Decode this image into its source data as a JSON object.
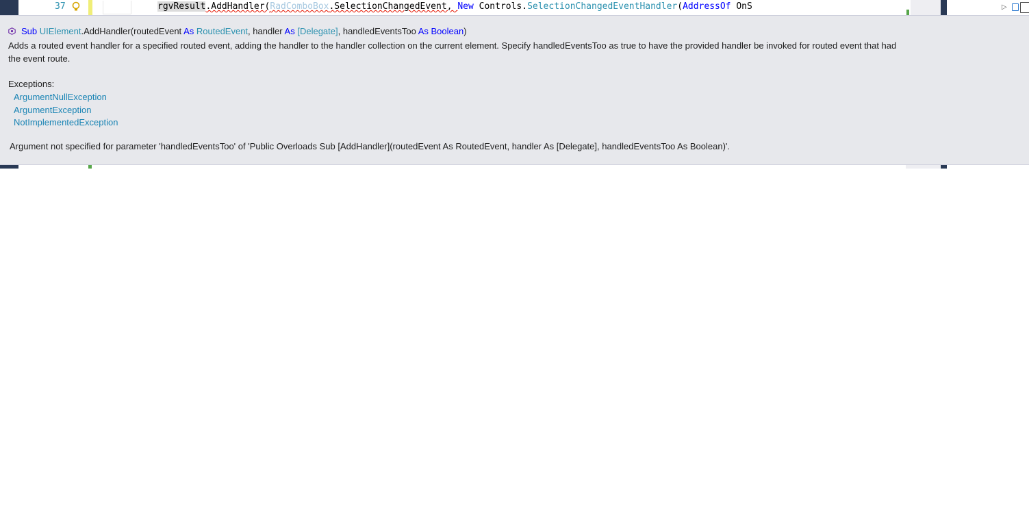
{
  "editor": {
    "line_number": "37",
    "code": {
      "receiver": "rgvResult",
      "method": ".AddHandler(",
      "arg1_type": "RadComboBox",
      "arg1_member": ".SelectionChangedEvent, ",
      "kw_new": "New",
      "arg2_ns": " Controls.",
      "arg2_type": "SelectionChangedEventHandler",
      "arg2_open": "(",
      "kw_addressof": "AddressOf",
      "tail": " OnS"
    }
  },
  "tooltip": {
    "signature": {
      "kw_sub": "Sub",
      "owner_type": "UIElement",
      "method": ".AddHandler(routedEvent ",
      "kw_as1": "As",
      "type1": "RoutedEvent",
      "param2": ", handler ",
      "kw_as2": "As",
      "type2": "[Delegate]",
      "param3": ", handledEventsToo ",
      "kw_as3": "As",
      "type3": "Boolean",
      "close": ")"
    },
    "description_line1": "Adds a routed event handler for a specified routed event, adding the handler to the handler collection on the current element. Specify handledEventsToo as true to have the provided handler be invoked for routed event that had",
    "description_line2": "the event route.",
    "exceptions_header": "Exceptions:",
    "exceptions": [
      "ArgumentNullException",
      "ArgumentException",
      "NotImplementedException"
    ],
    "error_message": "Argument not specified for parameter 'handledEventsToo' of 'Public Overloads Sub [AddHandler](routedEvent As RoutedEvent, handler As [Delegate], handledEventsToo As Boolean)'."
  },
  "colors": {
    "keyword": "#0000ff",
    "type": "#2b91af",
    "exception_link": "#1a84b4",
    "tooltip_bg": "#e7e8ec",
    "ide_dark": "#293955"
  },
  "icons": {
    "gutter": "lightbulb-icon",
    "signature": "method-icon",
    "tree_expand": "expand-arrow-icon",
    "tree_lock": "lock-icon",
    "tree_file": "file-icon"
  }
}
